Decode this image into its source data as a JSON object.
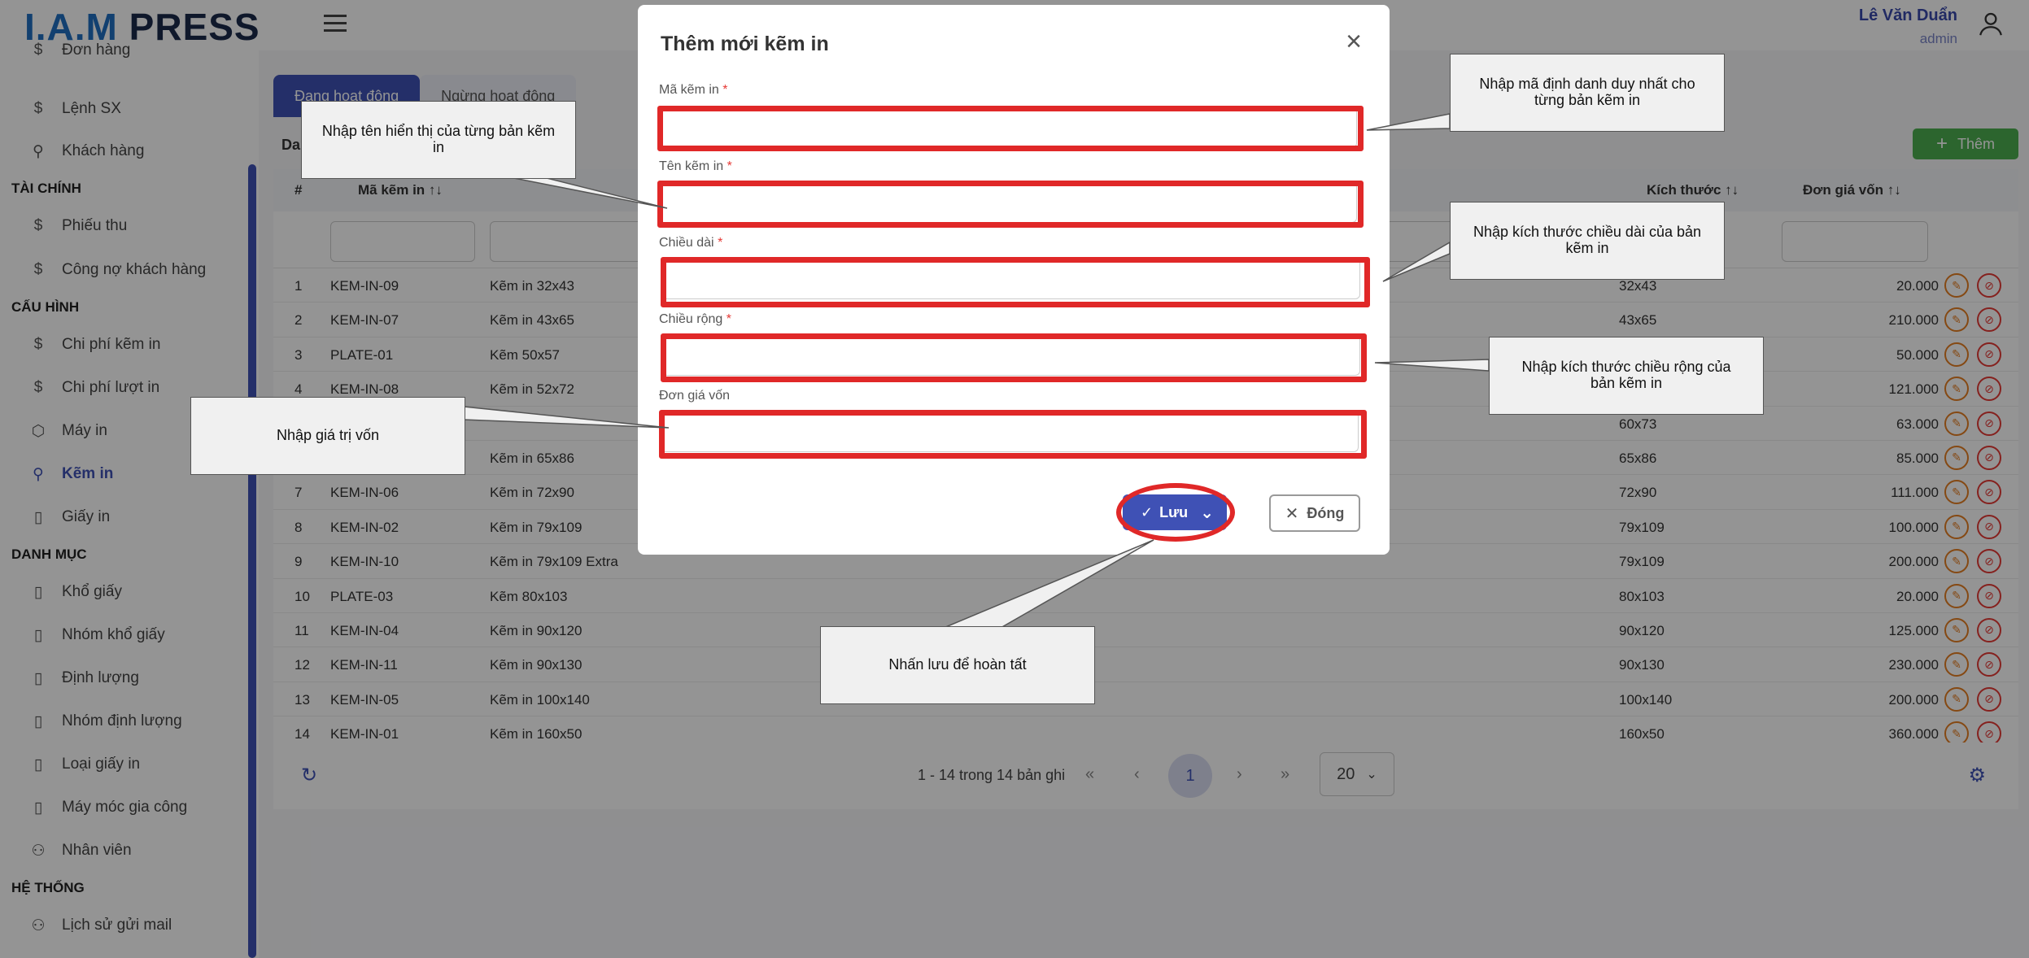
{
  "header": {
    "logo_part1": "I.A.M",
    "logo_part2": "PRESS",
    "user_name": "Lê Văn Duẩn",
    "user_role": "admin"
  },
  "sidebar": {
    "items": [
      {
        "label": "Đơn hàng",
        "icon": "dollar-icon"
      },
      {
        "label": "Lệnh SX",
        "icon": "dollar-icon"
      },
      {
        "label": "Khách hàng",
        "icon": "users-icon"
      },
      {
        "section": "TÀI CHÍNH"
      },
      {
        "label": "Phiếu thu",
        "icon": "dollar-icon"
      },
      {
        "label": "Công nợ khách hàng",
        "icon": "dollar-icon"
      },
      {
        "section": "CẤU HÌNH"
      },
      {
        "label": "Chi phí kẽm in",
        "icon": "dollar-icon"
      },
      {
        "label": "Chi phí lượt in",
        "icon": "dollar-icon"
      },
      {
        "label": "Máy in",
        "icon": "box-icon"
      },
      {
        "label": "Kẽm in",
        "icon": "users-icon",
        "active": true
      },
      {
        "label": "Giấy in",
        "icon": "file-icon"
      },
      {
        "section": "DANH MỤC"
      },
      {
        "label": "Khổ giấy",
        "icon": "file-icon"
      },
      {
        "label": "Nhóm khổ giấy",
        "icon": "file-icon"
      },
      {
        "label": "Định lượng",
        "icon": "file-icon"
      },
      {
        "label": "Nhóm định lượng",
        "icon": "file-icon"
      },
      {
        "label": "Loại giấy in",
        "icon": "file-icon"
      },
      {
        "label": "Máy móc gia công",
        "icon": "file-icon"
      },
      {
        "label": "Nhân viên",
        "icon": "user-icon"
      },
      {
        "section": "HỆ THỐNG"
      },
      {
        "label": "Lịch sử gửi mail",
        "icon": "user-icon"
      }
    ]
  },
  "tabs": [
    {
      "label": "Đang hoạt động",
      "active": true
    },
    {
      "label": "Ngừng hoạt động",
      "active": false
    }
  ],
  "toolbar": {
    "data_label": "Da",
    "add_label": "Thêm"
  },
  "table": {
    "columns": {
      "index": "#",
      "code": "Mã kẽm in ↑↓",
      "size": "Kích thước ↑↓",
      "price": "Đơn giá vốn ↑↓"
    },
    "rows": [
      {
        "no": "1",
        "code": "KEM-IN-09",
        "name": "Kẽm in 32x43",
        "size": "32x43",
        "price": "20.000"
      },
      {
        "no": "2",
        "code": "KEM-IN-07",
        "name": "Kẽm in 43x65",
        "size": "43x65",
        "price": "210.000"
      },
      {
        "no": "3",
        "code": "PLATE-01",
        "name": "Kẽm 50x57",
        "size": "",
        "price": "50.000"
      },
      {
        "no": "4",
        "code": "KEM-IN-08",
        "name": "Kẽm in 52x72",
        "size": "",
        "price": "121.000"
      },
      {
        "no": "",
        "code": "",
        "name": "",
        "size": "60x73",
        "price": "63.000"
      },
      {
        "no": "",
        "code": "",
        "name": "Kẽm in 65x86",
        "size": "65x86",
        "price": "85.000"
      },
      {
        "no": "7",
        "code": "KEM-IN-06",
        "name": "Kẽm in 72x90",
        "size": "72x90",
        "price": "111.000"
      },
      {
        "no": "8",
        "code": "KEM-IN-02",
        "name": "Kẽm in 79x109",
        "size": "79x109",
        "price": "100.000"
      },
      {
        "no": "9",
        "code": "KEM-IN-10",
        "name": "Kẽm in 79x109 Extra",
        "size": "79x109",
        "price": "200.000"
      },
      {
        "no": "10",
        "code": "PLATE-03",
        "name": "Kẽm 80x103",
        "size": "80x103",
        "price": "20.000"
      },
      {
        "no": "11",
        "code": "KEM-IN-04",
        "name": "Kẽm in 90x120",
        "size": "90x120",
        "price": "125.000"
      },
      {
        "no": "12",
        "code": "KEM-IN-11",
        "name": "Kẽm in 90x130",
        "size": "90x130",
        "price": "230.000"
      },
      {
        "no": "13",
        "code": "KEM-IN-05",
        "name": "Kẽm in 100x140",
        "size": "100x140",
        "price": "200.000"
      },
      {
        "no": "14",
        "code": "KEM-IN-01",
        "name": "Kẽm in 160x50",
        "size": "160x50",
        "price": "360.000"
      }
    ]
  },
  "pagination": {
    "info": "1 - 14 trong 14 bản ghi",
    "current_page": "1",
    "page_size": "20"
  },
  "modal": {
    "title": "Thêm mới kẽm in",
    "fields": [
      {
        "label": "Mã kẽm in",
        "required": true,
        "value": ""
      },
      {
        "label": "Tên kẽm in",
        "required": true,
        "value": ""
      },
      {
        "label": "Chiều dài",
        "required": true,
        "value": ""
      },
      {
        "label": "Chiều rộng",
        "required": true,
        "value": ""
      },
      {
        "label": "Đơn giá vốn",
        "required": false,
        "value": ""
      }
    ],
    "save_label": "Lưu",
    "close_label": "Đóng"
  },
  "callouts": {
    "code": "Nhập mã định danh duy nhất cho từng bản kẽm in",
    "name": "Nhập tên hiển thị của từng bản kẽm in",
    "length": "Nhập kích thước chiều dài của bản kẽm in",
    "width": "Nhập kích thước chiều rộng của bản kẽm in",
    "price": "Nhập giá trị vốn",
    "save": "Nhấn lưu để hoàn tất"
  },
  "colors": {
    "primary": "#3f51b5",
    "highlight": "#e02828",
    "add_button": "#4caf50"
  }
}
